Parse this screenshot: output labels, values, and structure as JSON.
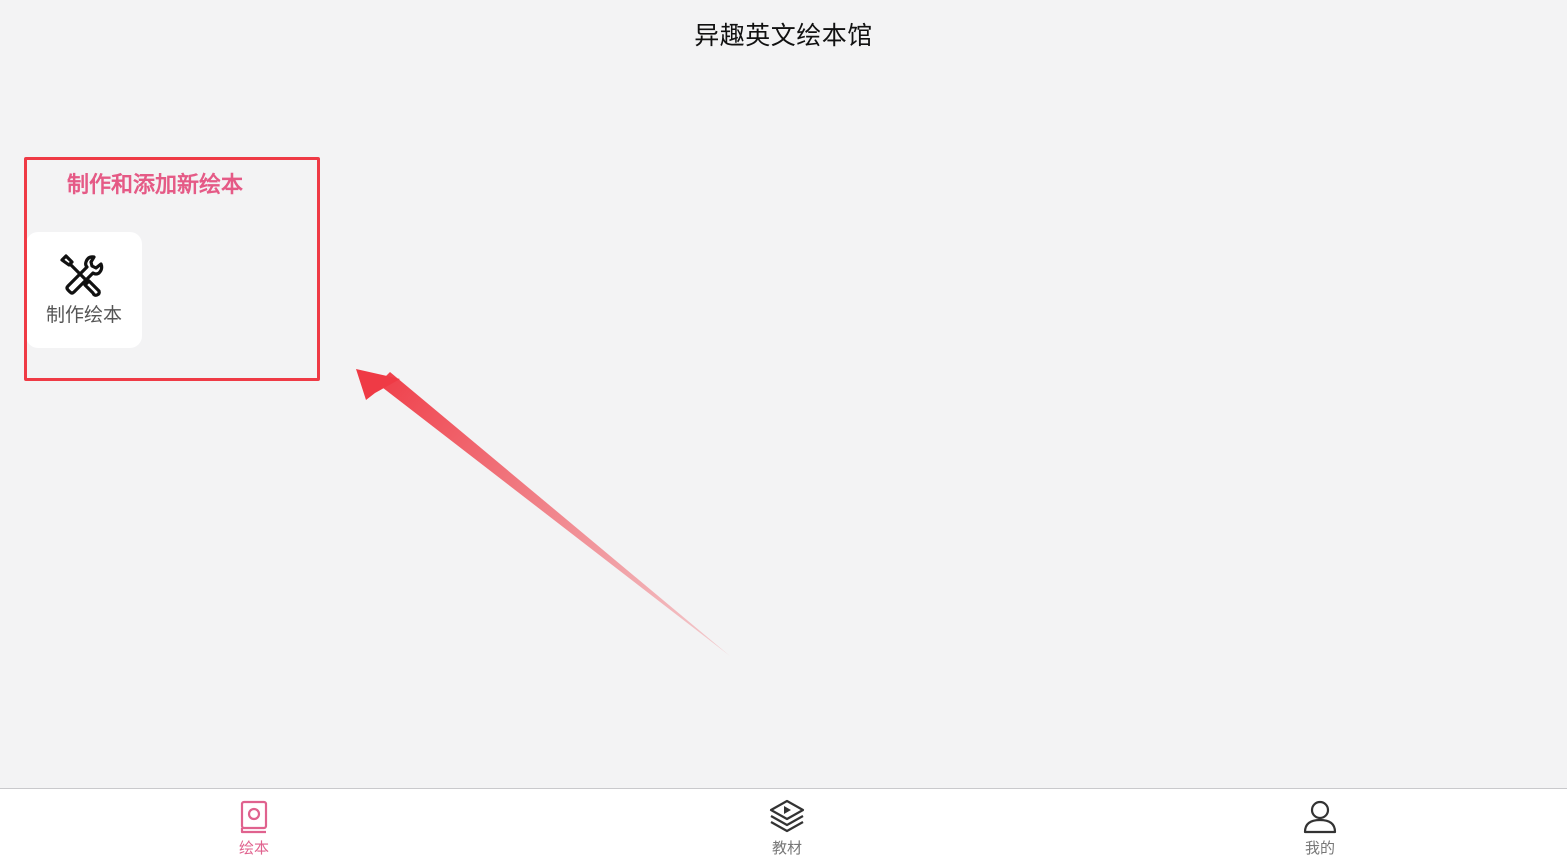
{
  "header": {
    "title": "异趣英文绘本馆"
  },
  "main": {
    "annotation_label": "制作和添加新绘本",
    "make_card": {
      "label": "制作绘本",
      "icon": "tools-icon"
    }
  },
  "tabbar": {
    "tabs": [
      {
        "label": "绘本",
        "icon": "book-icon",
        "active": true
      },
      {
        "label": "教材",
        "icon": "stack-play-icon",
        "active": false
      },
      {
        "label": "我的",
        "icon": "user-icon",
        "active": false
      }
    ]
  },
  "colors": {
    "accent": "#e0628e",
    "annotation_red": "#ef3a45",
    "background": "#f3f3f4"
  }
}
